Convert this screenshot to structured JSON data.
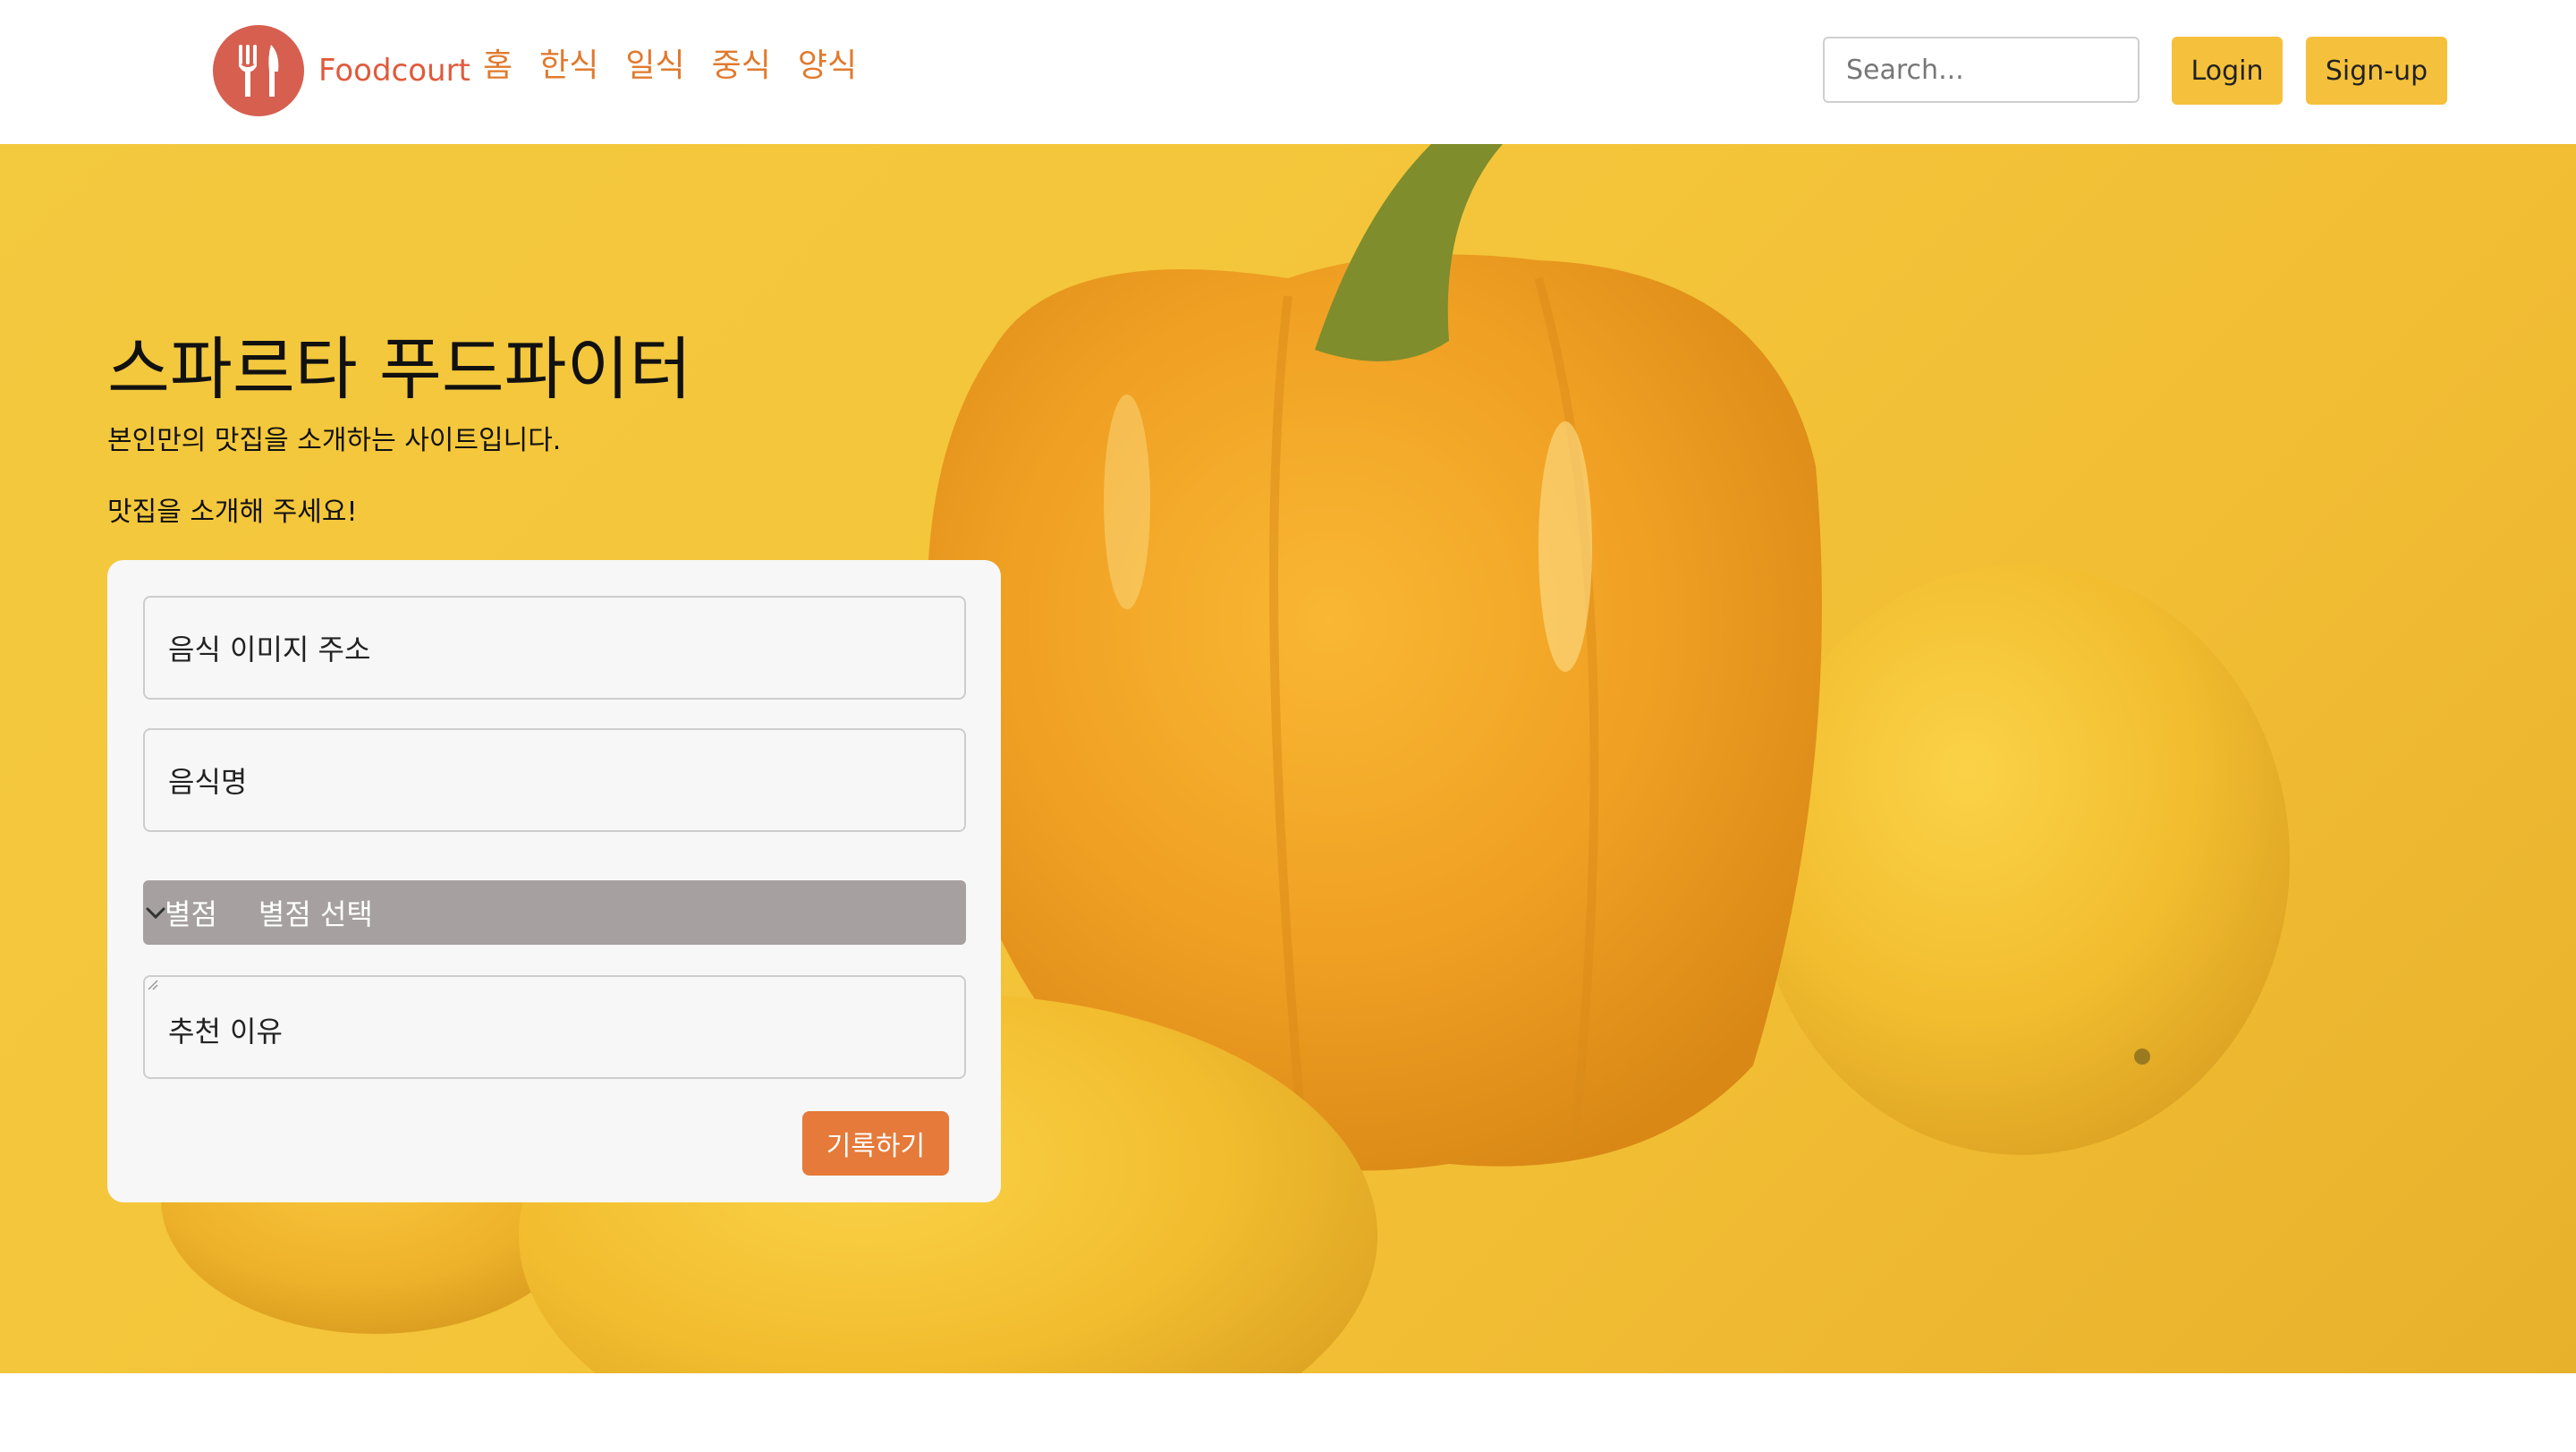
{
  "navbar": {
    "brand": "Foodcourt",
    "links": [
      "홈",
      "한식",
      "일식",
      "중식",
      "양식"
    ],
    "search_placeholder": "Search...",
    "login_label": "Login",
    "signup_label": "Sign-up"
  },
  "hero": {
    "title": "스파르타 푸드파이터",
    "subtitle": "본인만의 맛집을 소개하는 사이트입니다.",
    "subtitle2": "맛집을 소개해 주세요!"
  },
  "form": {
    "image_url_placeholder": "음식 이미지 주소",
    "food_name_placeholder": "음식명",
    "rating_label": "별점",
    "rating_selected": "별점 선택",
    "reason_placeholder": "추천 이유",
    "submit_label": "기록하기"
  },
  "colors": {
    "accent": "#e07a2e",
    "brand": "#e05a3c",
    "button_yellow": "#f5c13c",
    "submit": "#e57a3a",
    "hero_bg": "#f3c93e"
  },
  "icons": {
    "logo": "fork-knife-icon",
    "select_arrow": "chevron-down-icon"
  }
}
